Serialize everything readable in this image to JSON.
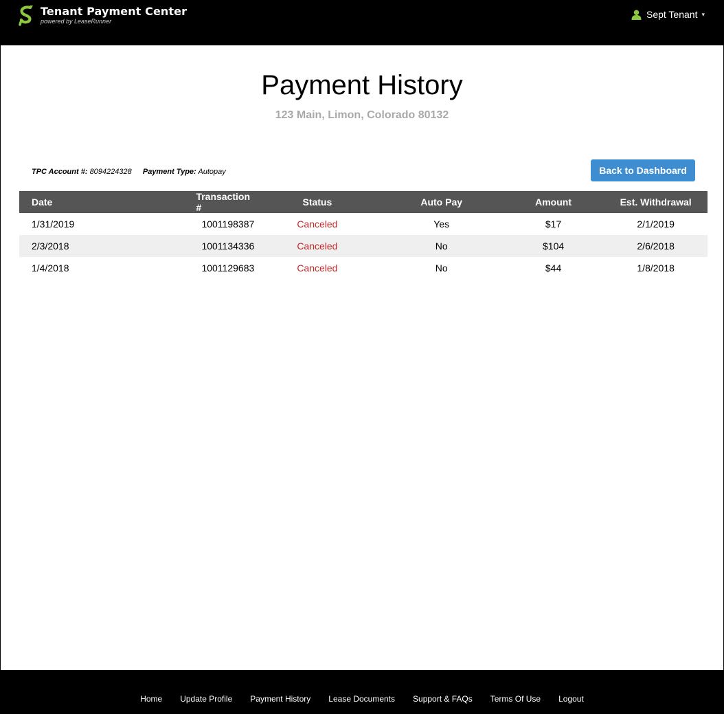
{
  "header": {
    "app_title": "Tenant Payment Center",
    "app_subtitle": "powered by LeaseRunner",
    "brand_color": "#8dc63f",
    "user_name": "Sept Tenant",
    "user_icon": "user-icon",
    "caret_icon": "chevron-down-icon"
  },
  "page": {
    "title": "Payment History",
    "address": "123 Main, Limon, Colorado 80132"
  },
  "account": {
    "account_label": "TPC Account #:",
    "account_number": "8094224328",
    "payment_type_label": "Payment Type:",
    "payment_type": "Autopay"
  },
  "actions": {
    "back_label": "Back to Dashboard",
    "back_color": "#3f8dd1"
  },
  "table": {
    "columns": [
      "Date",
      "Transaction #",
      "Status",
      "Auto Pay",
      "Amount",
      "Est. Withdrawal"
    ],
    "rows": [
      {
        "date": "1/31/2019",
        "txn": "1001198387",
        "status": "Canceled",
        "autopay": "Yes",
        "amount": "$17",
        "withdrawal": "2/1/2019"
      },
      {
        "date": "2/3/2018",
        "txn": "1001134336",
        "status": "Canceled",
        "autopay": "No",
        "amount": "$104",
        "withdrawal": "2/6/2018"
      },
      {
        "date": "1/4/2018",
        "txn": "1001129683",
        "status": "Canceled",
        "autopay": "No",
        "amount": "$44",
        "withdrawal": "1/8/2018"
      }
    ],
    "status_color": "#c62828"
  },
  "footer": {
    "links": [
      "Home",
      "Update Profile",
      "Payment History",
      "Lease Documents",
      "Support & FAQs",
      "Terms Of Use",
      "Logout"
    ]
  }
}
